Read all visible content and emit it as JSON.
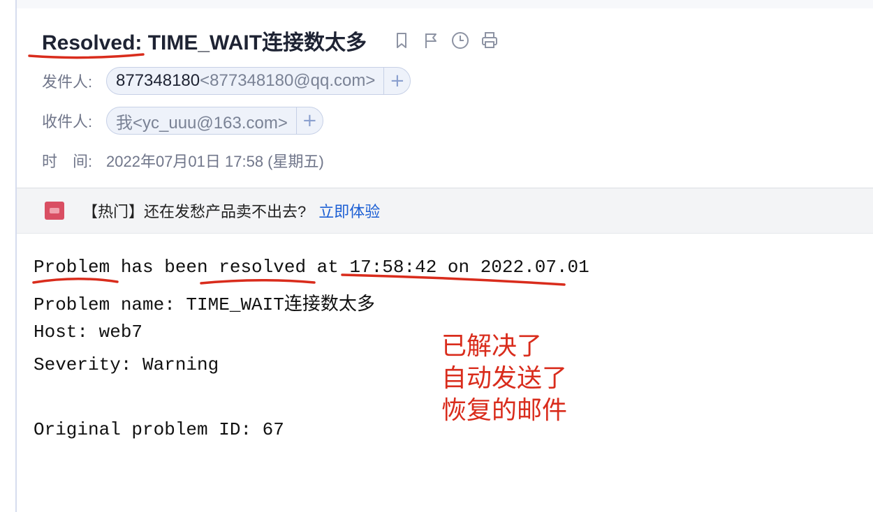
{
  "mail": {
    "subject": "Resolved: TIME_WAIT连接数太多",
    "from": {
      "label": "发件人:",
      "name": "877348180",
      "address": "<877348180@qq.com>"
    },
    "to": {
      "label": "收件人:",
      "name": "我",
      "address": "<yc_uuu@163.com>"
    },
    "time": {
      "label": "时　间:",
      "value": "2022年07月01日 17:58 (星期五)"
    },
    "add_symbol": "+"
  },
  "toolbar": {
    "icons": [
      "bookmark-icon",
      "flag-icon",
      "clock-icon",
      "print-icon"
    ]
  },
  "ad": {
    "text": "【热门】还在发愁产品卖不出去?",
    "link": "立即体验"
  },
  "body": {
    "lines": [
      "Problem has been resolved at 17:58:42 on 2022.07.01",
      "Problem name: TIME_WAIT连接数太多",
      "Host: web7",
      "Severity: Warning",
      "Original problem ID: 67"
    ]
  },
  "annotation": {
    "lines": [
      "已解决了",
      "自动发送了",
      "恢复的邮件"
    ],
    "color": "#d92c1c"
  }
}
